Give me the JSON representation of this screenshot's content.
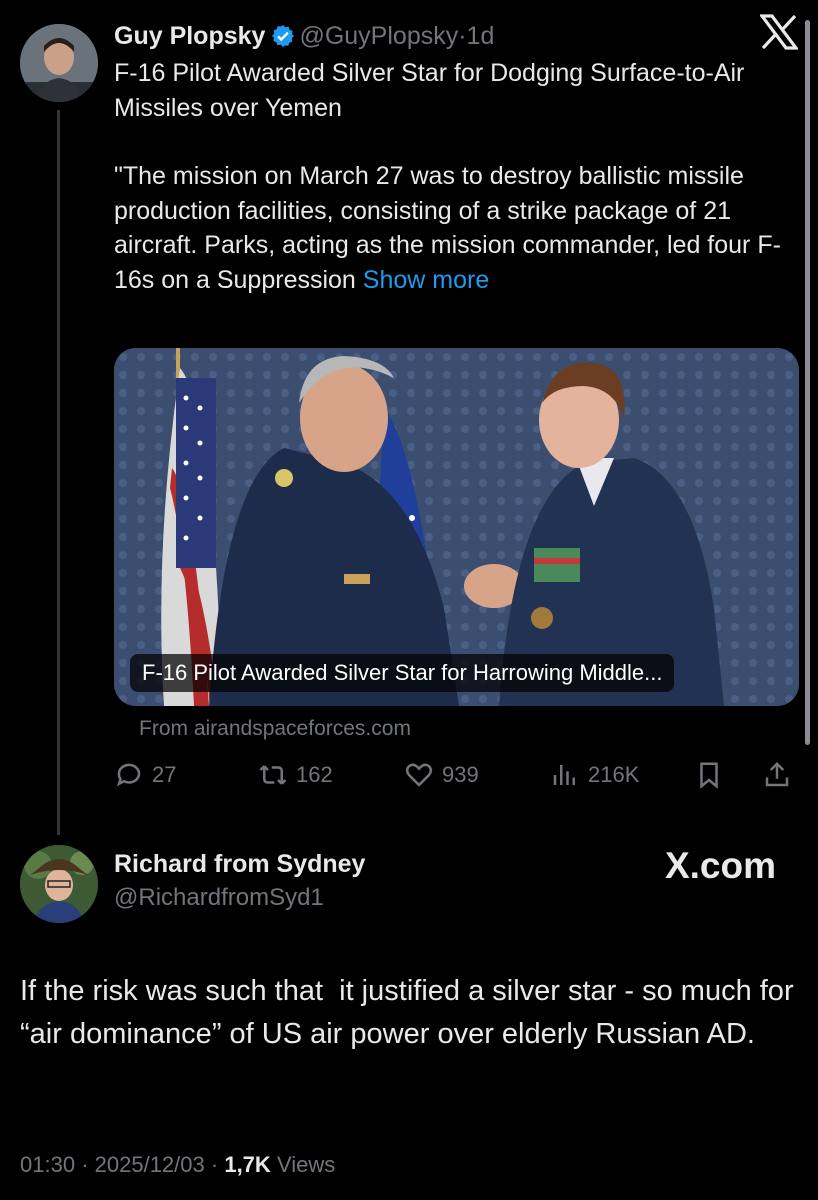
{
  "tweet": {
    "author_name": "Guy Plopsky",
    "handle": "@GuyPlopsky",
    "separator": "·",
    "time": "1d",
    "text_lines": [
      "F-16 Pilot Awarded Silver Star for Dodging Surface-to-Air Missiles over Yemen"
    ],
    "quote_text": "\"The mission on March 27 was to destroy ballistic missile production facilities, consisting of a strike package of 21 aircraft. Parks, acting as the mission commander, led four F-16s on a Suppression",
    "show_more": "Show more",
    "card": {
      "caption": "F-16 Pilot Awarded Silver Star for Harrowing Middle...",
      "source": "From airandspaceforces.com"
    },
    "actions": {
      "replies": "27",
      "reposts": "162",
      "likes": "939",
      "views": "216K"
    }
  },
  "reply": {
    "author_name": "Richard from Sydney",
    "handle": "@RichardfromSyd1",
    "text": "If the risk was such that  it justified a silver star - so much for “air dominance” of US air power over elderly Russian AD.",
    "time": "01:30",
    "date": "2025/12/03",
    "views_count": "1,7K",
    "views_label": "Views",
    "sep": "·"
  },
  "watermark": "X.com",
  "logo_icon": "x-logo-icon",
  "colors": {
    "background": "#000000",
    "text": "#e7e9ea",
    "muted": "#71767b",
    "link": "#1d9bf0",
    "verified": "#1d9bf0"
  }
}
